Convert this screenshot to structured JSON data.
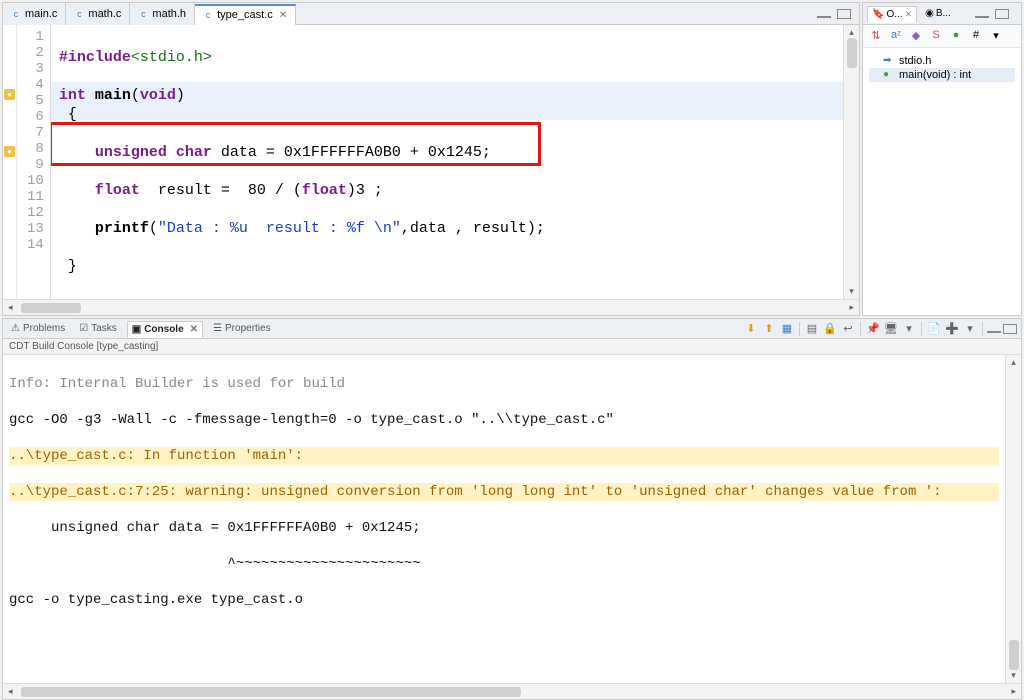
{
  "editor": {
    "tabs": [
      {
        "label": "main.c",
        "icon": "c"
      },
      {
        "label": "math.c",
        "icon": "c"
      },
      {
        "label": "math.h",
        "icon": "h"
      },
      {
        "label": "type_cast.c",
        "icon": "c",
        "active": true
      }
    ],
    "lines": {
      "l1": "",
      "l2_a": "#include",
      "l2_b": "<stdio.h>",
      "l3": "",
      "l4_a": "int",
      "l4_b": " main",
      "l4_c": "(",
      "l4_d": "void",
      "l4_e": ")",
      "l5": " {",
      "l6": "",
      "l7_a": "unsigned",
      "l7_b": " char",
      "l7_c": " data = 0x1FFFFFFA0B0 + 0x1245;",
      "l8": "",
      "l9_a": "float",
      "l9_b": "  result =  80 / (",
      "l9_c": "float",
      "l9_d": ")3 ;",
      "l10": "",
      "l11_a": "printf",
      "l11_b": "(",
      "l11_c": "\"Data : %u  result : %f \\n\"",
      "l11_d": ",data , result);",
      "l12": "",
      "l13": " }",
      "l14": ""
    },
    "gutter": [
      "1",
      "2",
      "3",
      "4",
      "5",
      "6",
      "7",
      "8",
      "9",
      "10",
      "11",
      "12",
      "13",
      "14"
    ]
  },
  "outline": {
    "tab1": "O...",
    "tab2": "B...",
    "items": [
      {
        "icon": "📘",
        "label": "stdio.h"
      },
      {
        "icon": "●",
        "label": "main(void) : int",
        "sel": true
      }
    ]
  },
  "bottomTabs": {
    "problems": "Problems",
    "tasks": "Tasks",
    "console": "Console",
    "properties": "Properties"
  },
  "console": {
    "subtitle": "CDT Build Console [type_casting]",
    "l0": "Info: Internal Builder is used for build",
    "l1": "gcc -O0 -g3 -Wall -c -fmessage-length=0 -o type_cast.o \"..\\\\type_cast.c\"",
    "l2": "..\\type_cast.c: In function 'main':",
    "l3": "..\\type_cast.c:7:25: warning: unsigned conversion from 'long long int' to 'unsigned char' changes value from ':",
    "l4": "     unsigned char data = 0x1FFFFFFA0B0 + 0x1245;",
    "l5": "                          ^~~~~~~~~~~~~~~~~~~~~~~",
    "l6": "gcc -o type_casting.exe type_cast.o",
    "l7": ""
  },
  "icons": {
    "close": "✕",
    "down": "▾",
    "up": "▴",
    "left": "◂",
    "right": "▸"
  }
}
